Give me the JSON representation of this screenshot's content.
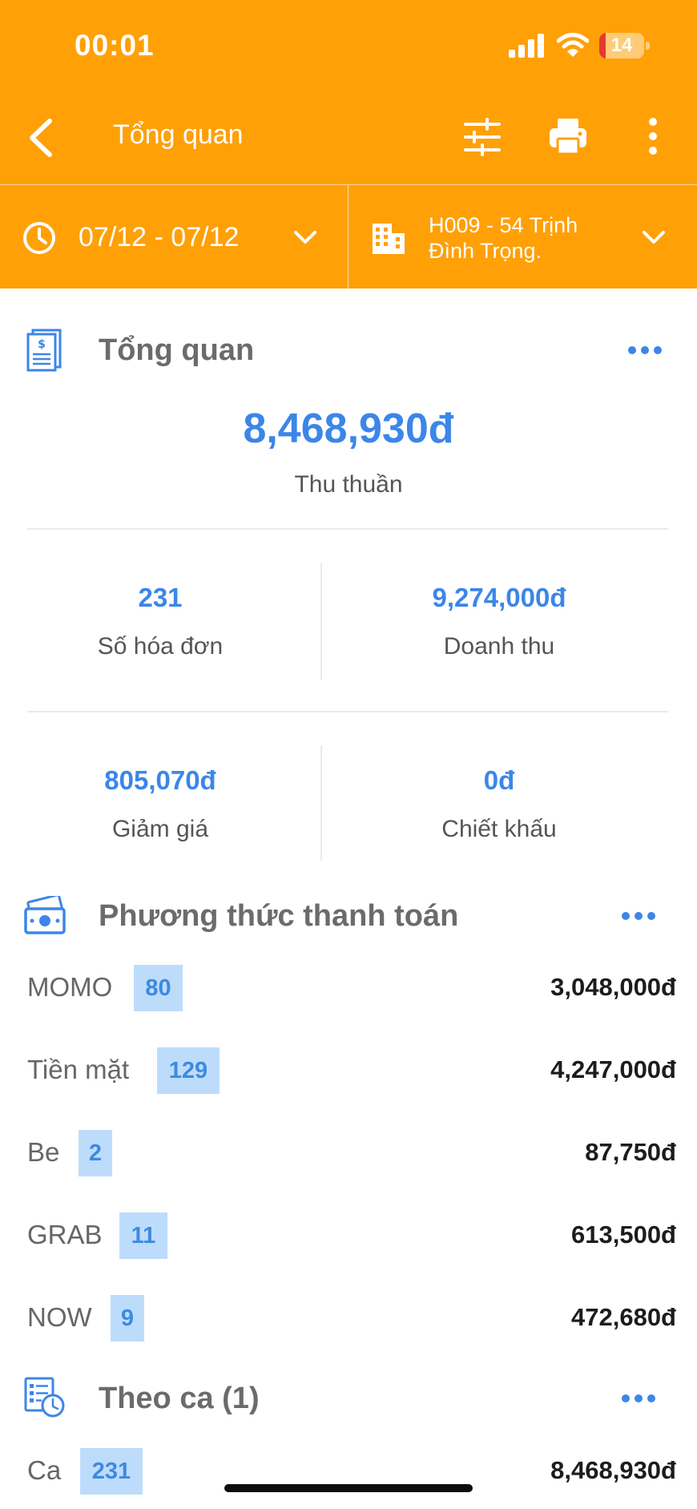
{
  "status_bar": {
    "time": "00:01",
    "battery": "14",
    "battery_level": 0.14
  },
  "nav": {
    "title": "Tổng quan"
  },
  "filters": {
    "date_range": "07/12 - 07/12",
    "branch_line1": "H009 - 54 Trịnh",
    "branch_line2": "Đình Trọng."
  },
  "overview": {
    "title": "Tổng quan",
    "net_revenue": "8,468,930đ",
    "net_revenue_label": "Thu thuần",
    "stats": [
      {
        "value": "231",
        "label": "Số hóa đơn"
      },
      {
        "value": "9,274,000đ",
        "label": "Doanh thu"
      },
      {
        "value": "805,070đ",
        "label": "Giảm giá"
      },
      {
        "value": "0đ",
        "label": "Chiết khấu"
      }
    ]
  },
  "payment": {
    "title": "Phương thức thanh toán",
    "items": [
      {
        "name": "MOMO",
        "count": "80",
        "amount": "3,048,000đ"
      },
      {
        "name": "Tiền mặt",
        "count": "129",
        "amount": "4,247,000đ"
      },
      {
        "name": "Be",
        "count": "2",
        "amount": "87,750đ"
      },
      {
        "name": "GRAB",
        "count": "11",
        "amount": "613,500đ"
      },
      {
        "name": "NOW",
        "count": "9",
        "amount": "472,680đ"
      }
    ]
  },
  "shifts": {
    "title": "Theo ca (1)",
    "items": [
      {
        "name": "Ca",
        "count": "231",
        "amount": "8,468,930đ"
      }
    ]
  },
  "colors": {
    "brand": "#FFA007",
    "accent": "#3C86E8",
    "badge_bg": "#BDDCFB"
  }
}
